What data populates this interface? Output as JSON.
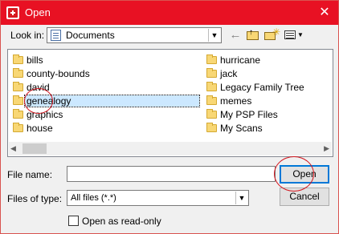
{
  "window": {
    "title": "Open",
    "close_label": "✕"
  },
  "toolbar": {
    "lookin_label": "Look in:",
    "lookin_value": "Documents",
    "back_icon": "←"
  },
  "files": [
    {
      "name": "bills",
      "selected": false
    },
    {
      "name": "county-bounds",
      "selected": false
    },
    {
      "name": "david",
      "selected": false
    },
    {
      "name": "genealogy",
      "selected": true
    },
    {
      "name": "graphics",
      "selected": false
    },
    {
      "name": "house",
      "selected": false
    },
    {
      "name": "hurricane",
      "selected": false
    },
    {
      "name": "jack",
      "selected": false
    },
    {
      "name": "Legacy Family Tree",
      "selected": false
    },
    {
      "name": "memes",
      "selected": false
    },
    {
      "name": "My PSP Files",
      "selected": false
    },
    {
      "name": "My Scans",
      "selected": false
    }
  ],
  "form": {
    "filename_label": "File name:",
    "filename_value": "",
    "filetype_label": "Files of type:",
    "filetype_value": "All files (*.*)",
    "readonly_label": "Open as read-only",
    "readonly_checked": false
  },
  "buttons": {
    "open": "Open",
    "cancel": "Cancel"
  },
  "colors": {
    "title_bar": "#e81123",
    "selection": "#cce8ff",
    "annotation_circle": "#d2141c",
    "default_button_border": "#0078d7"
  }
}
